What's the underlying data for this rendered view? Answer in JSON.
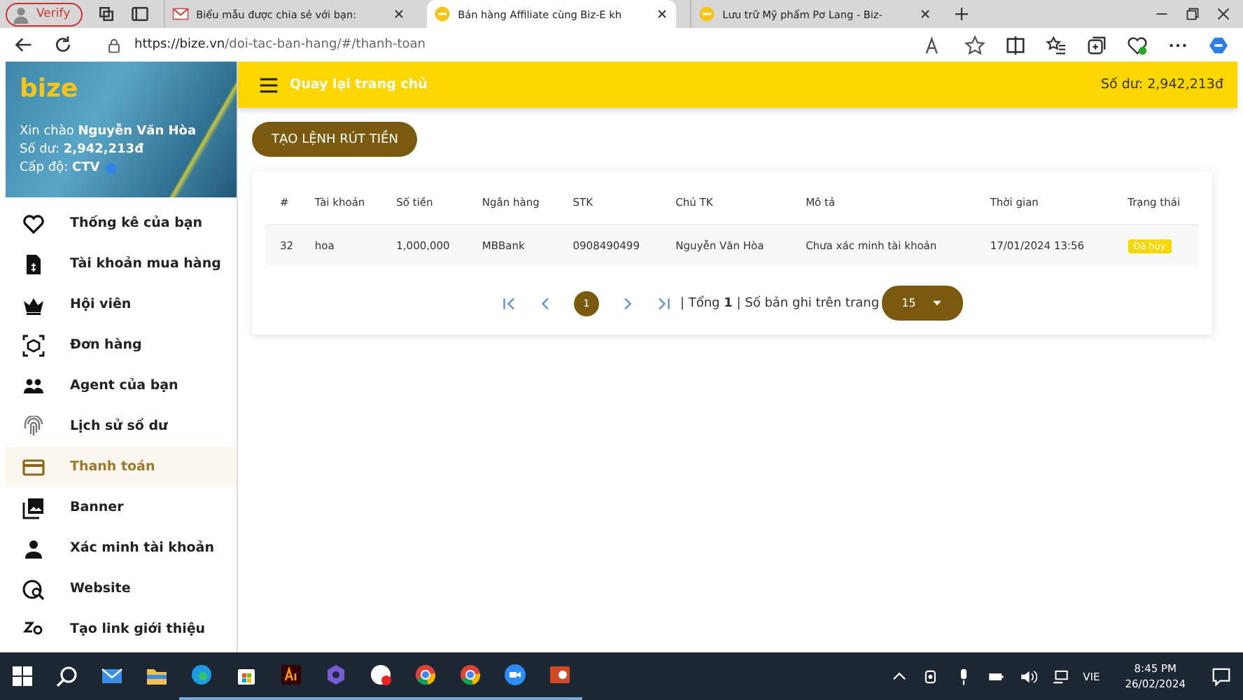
{
  "browser": {
    "profile": "Verify",
    "tabs": [
      {
        "title": "Biểu mẫu được chia sẻ với bạn:",
        "selected": false
      },
      {
        "title": "Bán hàng Affiliate cùng Biz-E kh",
        "selected": true
      },
      {
        "title": "Lưu trữ Mỹ phẩm Pơ Lang - Biz-",
        "selected": false
      }
    ],
    "url_host": "https://bize.vn",
    "url_path": "/doi-tac-ban-hang/#/thanh-toan"
  },
  "sidebar": {
    "logo": "bize",
    "greeting": "Xin chào **Nguyễn Văn Hòa**",
    "balance": "Số dư: **2,942,213đ**",
    "level": "Cấp độ: **CTV**",
    "items": [
      {
        "label": "Thống kê của bạn",
        "selected": false
      },
      {
        "label": "Tài khoản mua hàng",
        "selected": false
      },
      {
        "label": "Hội viên",
        "selected": false
      },
      {
        "label": "Đơn hàng",
        "selected": false
      },
      {
        "label": "Agent của bạn",
        "selected": false
      },
      {
        "label": "Lịch sử số dư",
        "selected": false
      },
      {
        "label": "Thanh toán",
        "selected": true
      },
      {
        "label": "Banner",
        "selected": false
      },
      {
        "label": "Xác minh tài khoản",
        "selected": false
      },
      {
        "label": "Website",
        "selected": false
      },
      {
        "label": "Tạo link giới thiệu",
        "selected": false
      }
    ]
  },
  "topbar": {
    "back": "Quay lại trang chủ",
    "balance": "Số dư: 2,942,213đ"
  },
  "withdraw_button": "TẠO LỆNH RÚT TIỀN",
  "table": {
    "columns": [
      "#",
      "Tài khoản",
      "Số tiền",
      "Ngân hàng",
      "STK",
      "Chủ TK",
      "Mô tả",
      "Thời gian",
      "Trạng thái"
    ],
    "rows": [
      {
        "cells": [
          "32",
          "hoa",
          "1,000,000",
          "MBBank",
          "0908490499",
          "Nguyễn Văn Hòa",
          "Chưa xác minh tài khoản",
          "17/01/2024 13:56"
        ],
        "status": "Đã hủy"
      }
    ]
  },
  "pagination": {
    "pages": [
      {
        "label": "1",
        "selected": true
      }
    ],
    "summary": "| Tổng **1** | Số bản ghi trên trang",
    "per_page": "15"
  },
  "taskbar": {
    "language": "VIE",
    "time": "8:45 PM",
    "date": "26/02/2024"
  }
}
